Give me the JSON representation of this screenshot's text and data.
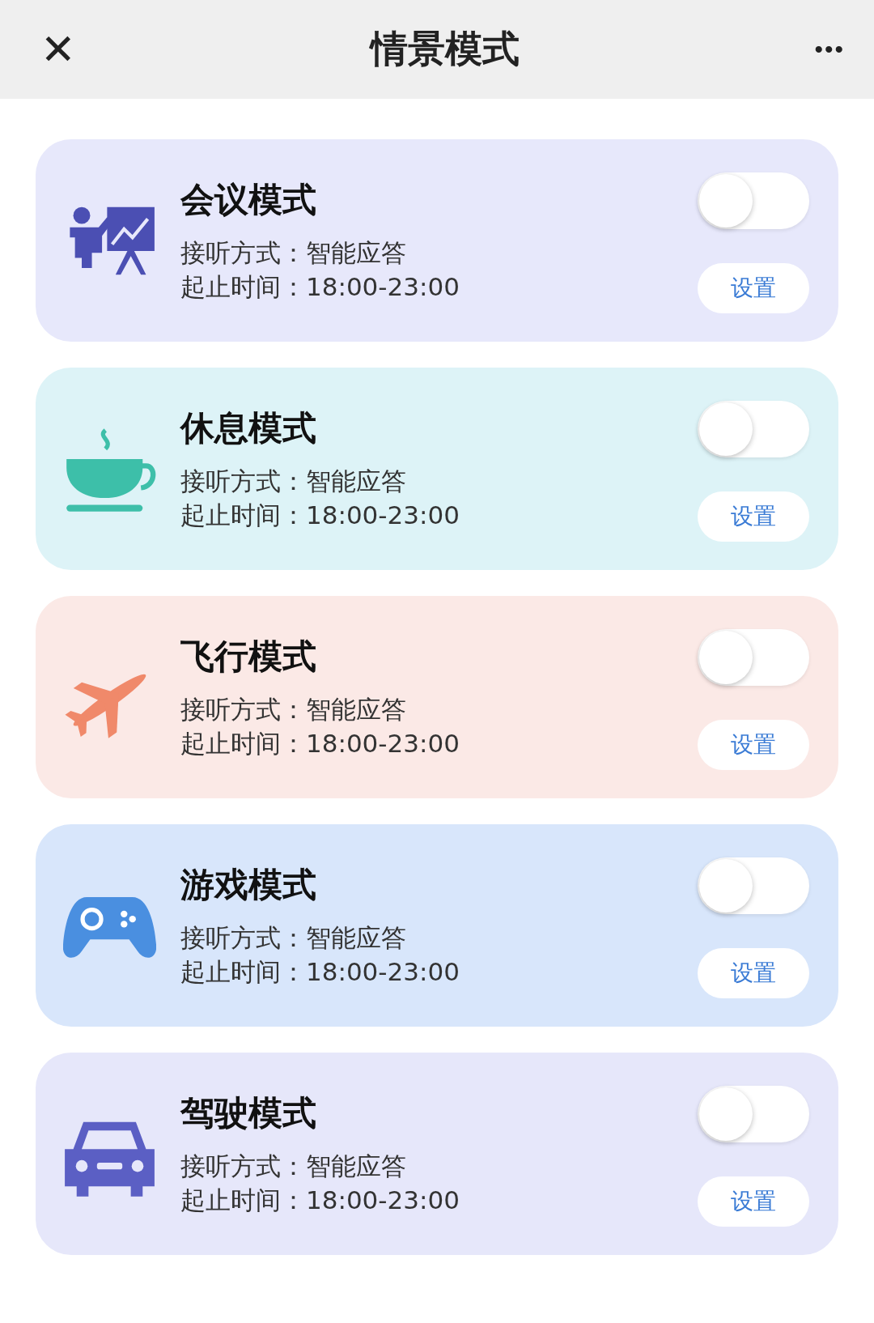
{
  "header": {
    "close": "✕",
    "title": "情景模式",
    "more": "•••"
  },
  "modes": [
    {
      "kind": "meeting",
      "title": "会议模式",
      "answer": "接听方式：智能应答",
      "time": "起止时间：18:00-23:00",
      "on": false,
      "color": "#4b4fb3",
      "button": "设置"
    },
    {
      "kind": "rest",
      "title": "休息模式",
      "answer": "接听方式：智能应答",
      "time": "起止时间：18:00-23:00",
      "on": false,
      "color": "#3dbfa9",
      "button": "设置"
    },
    {
      "kind": "flight",
      "title": "飞行模式",
      "answer": "接听方式：智能应答",
      "time": "起止时间：18:00-23:00",
      "on": false,
      "color": "#f0896a",
      "button": "设置"
    },
    {
      "kind": "game",
      "title": "游戏模式",
      "answer": "接听方式：智能应答",
      "time": "起止时间：18:00-23:00",
      "on": false,
      "color": "#4a8fe0",
      "button": "设置"
    },
    {
      "kind": "drive",
      "title": "驾驶模式",
      "answer": "接听方式：智能应答",
      "time": "起止时间：18:00-23:00",
      "on": false,
      "color": "#5b5fc4",
      "button": "设置"
    }
  ]
}
